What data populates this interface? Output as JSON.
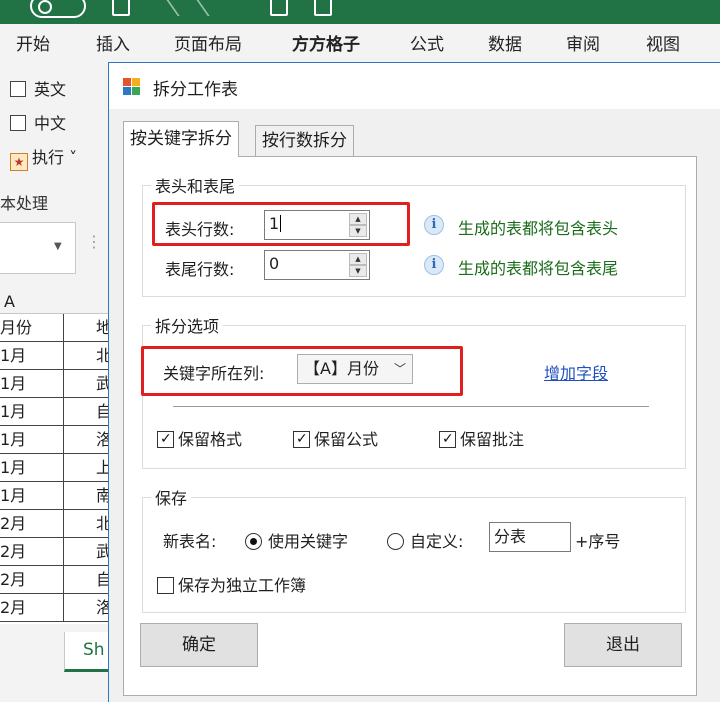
{
  "excel": {
    "ribbon_tabs": [
      "开始",
      "插入",
      "页面布局",
      "方方格子",
      "公式",
      "数据",
      "审阅",
      "视图"
    ],
    "ribbon_panel": {
      "checkbox_english": "英文",
      "checkbox_chinese": "中文",
      "execute_label": "执行 ˅",
      "group_label": "本处理"
    },
    "column_header": "A",
    "rows": [
      {
        "a": "月份",
        "b": "地"
      },
      {
        "a": "1月",
        "b": "北"
      },
      {
        "a": "1月",
        "b": "武"
      },
      {
        "a": "1月",
        "b": "自"
      },
      {
        "a": "1月",
        "b": "洛"
      },
      {
        "a": "1月",
        "b": "上"
      },
      {
        "a": "1月",
        "b": "南"
      },
      {
        "a": "2月",
        "b": "北"
      },
      {
        "a": "2月",
        "b": "武"
      },
      {
        "a": "2月",
        "b": "自"
      },
      {
        "a": "2月",
        "b": "洛"
      }
    ],
    "sheet_tab": "Sh"
  },
  "dialog": {
    "title": "拆分工作表",
    "tabs": [
      {
        "label": "按关键字拆分",
        "active": true
      },
      {
        "label": "按行数拆分",
        "active": false
      }
    ],
    "header_footer": {
      "group_title": "表头和表尾",
      "header_rows_label": "表头行数:",
      "header_rows_value": "1",
      "header_info": "生成的表都将包含表头",
      "footer_rows_label": "表尾行数:",
      "footer_rows_value": "0",
      "footer_info": "生成的表都将包含表尾"
    },
    "split_options": {
      "group_title": "拆分选项",
      "key_column_label": "关键字所在列:",
      "key_column_value": "【A】月份",
      "add_field_link": "增加字段",
      "keep_format": "保留格式",
      "keep_formula": "保留公式",
      "keep_comment": "保留批注"
    },
    "save": {
      "group_title": "保存",
      "new_name_label": "新表名:",
      "radio_keyword": "使用关键字",
      "radio_custom": "自定义:",
      "custom_value": "分表",
      "suffix": "+序号",
      "save_as_workbook": "保存为独立工作簿"
    },
    "ok_button": "确定",
    "exit_button": "退出"
  },
  "colors": {
    "excel_green": "#217346",
    "highlight_red": "#e02020",
    "info_text_green": "#1a6b1a",
    "link_blue": "#1f4fbf"
  }
}
